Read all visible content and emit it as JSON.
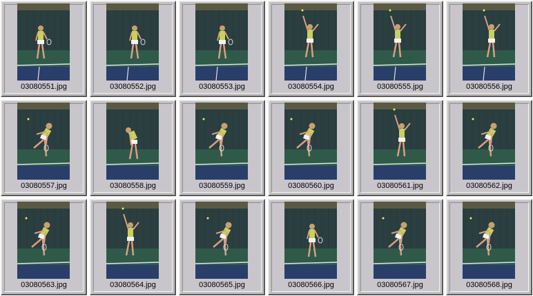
{
  "thumbnails": [
    {
      "filename": "03080551.jpg",
      "pose": "standing"
    },
    {
      "filename": "03080552.jpg",
      "pose": "standing"
    },
    {
      "filename": "03080553.jpg",
      "pose": "standing"
    },
    {
      "filename": "03080554.jpg",
      "pose": "reaching"
    },
    {
      "filename": "03080555.jpg",
      "pose": "reaching"
    },
    {
      "filename": "03080556.jpg",
      "pose": "reaching"
    },
    {
      "filename": "03080557.jpg",
      "pose": "lunging"
    },
    {
      "filename": "03080558.jpg",
      "pose": "bending"
    },
    {
      "filename": "03080559.jpg",
      "pose": "lunging"
    },
    {
      "filename": "03080560.jpg",
      "pose": "lunging"
    },
    {
      "filename": "03080561.jpg",
      "pose": "reaching"
    },
    {
      "filename": "03080562.jpg",
      "pose": "lunging"
    },
    {
      "filename": "03080563.jpg",
      "pose": "lunging"
    },
    {
      "filename": "03080564.jpg",
      "pose": "reaching"
    },
    {
      "filename": "03080565.jpg",
      "pose": "lunging"
    },
    {
      "filename": "03080566.jpg",
      "pose": "standing"
    },
    {
      "filename": "03080567.jpg",
      "pose": "lunging"
    },
    {
      "filename": "03080568.jpg",
      "pose": "lunging"
    }
  ],
  "colors": {
    "tile_face": "#c8c6cb",
    "sky": "#1e2a2c",
    "fence": "#2b3e40",
    "court": "#2f5a4a",
    "baseline": "#dfe6e8",
    "skin": "#d8a080",
    "shirt": "#c8d060",
    "skirt": "#f2f2f2",
    "hair": "#c8a070"
  }
}
